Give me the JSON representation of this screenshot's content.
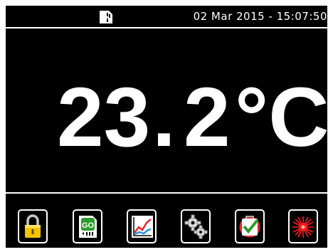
{
  "status_bar": {
    "datetime": "02 Mar 2015 - 15:07:50",
    "storage_icon": "sd-card-icon"
  },
  "reading": {
    "whole": "23",
    "decimal_point": ".",
    "fraction": "2",
    "unit": "°C"
  },
  "toolbar": {
    "buttons": [
      {
        "icon": "lock-icon"
      },
      {
        "icon": "go-sd-card-icon",
        "label": "GO"
      },
      {
        "icon": "trend-chart-icon"
      },
      {
        "icon": "settings-gears-icon"
      },
      {
        "icon": "alarm-check-icon"
      },
      {
        "icon": "laser-icon"
      }
    ]
  },
  "colors": {
    "screen_background": "#000000",
    "foreground": "#ffffff",
    "lock_gold": "#f5c400",
    "go_green": "#2e9b2e",
    "trend_red": "#e8282a",
    "trend_blue": "#2a8fe8",
    "laser_red": "#ff1a1a"
  }
}
